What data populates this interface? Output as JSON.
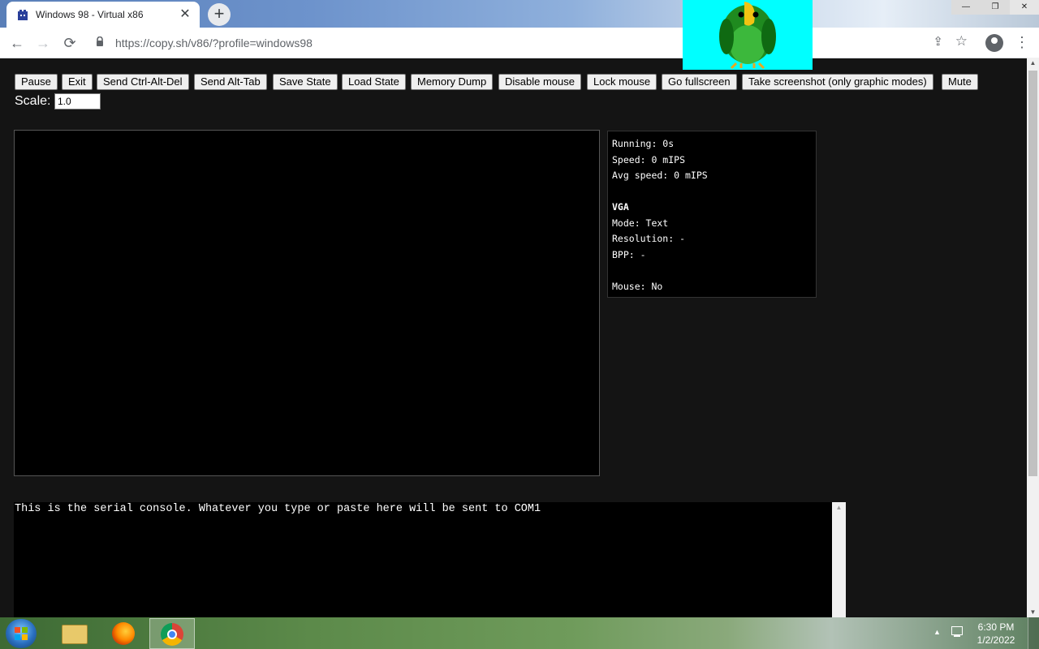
{
  "browser": {
    "tab_title": "Windows 98 - Virtual x86",
    "tab_close": "✕",
    "new_tab": "+",
    "url": "https://copy.sh/v86/?profile=windows98",
    "nav": {
      "back": "←",
      "forward": "→",
      "reload": "⟳"
    },
    "share_icon": "⇪",
    "star_icon": "☆",
    "menu_icon": "⋮",
    "window_controls": {
      "minimize": "—",
      "maximize": "❐",
      "close": "✕"
    }
  },
  "toolbar": {
    "buttons": [
      "Pause",
      "Exit",
      "Send Ctrl-Alt-Del",
      "Send Alt-Tab",
      "Save State",
      "Load State",
      "Memory Dump",
      "Disable mouse",
      "Lock mouse",
      "Go fullscreen",
      "Take screenshot (only graphic modes)",
      "Mute"
    ]
  },
  "scale": {
    "label": "Scale:",
    "value": "1.0"
  },
  "stats": {
    "running": "Running: 0s",
    "speed": "Speed: 0 mIPS",
    "avg_speed": "Avg speed: 0 mIPS",
    "vga_heading": "VGA",
    "mode": "Mode: Text",
    "resolution": "Resolution: -",
    "bpp": "BPP: -",
    "mouse": "Mouse: No"
  },
  "serial_console": {
    "text": "This is the serial console. Whatever you type or paste here will be sent to COM1"
  },
  "taskbar": {
    "clock_time": "6:30 PM",
    "clock_date": "1/2/2022",
    "tray_arrow": "▲"
  },
  "colors": {
    "page_bg": "#141414",
    "screen_bg": "#000000",
    "parrot_bg": "#00ffff"
  }
}
